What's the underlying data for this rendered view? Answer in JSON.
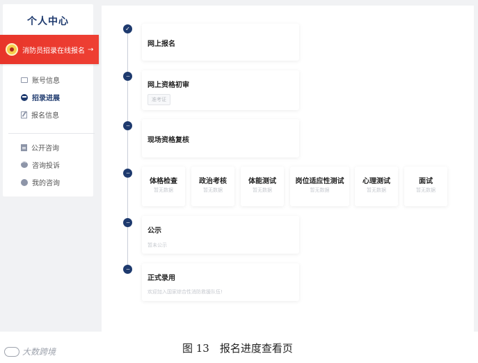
{
  "sidebar": {
    "title": "个人中心",
    "signup_button": "消防员招录在线报名",
    "signup_arrow": "→",
    "menu_primary": [
      {
        "label": "账号信息",
        "icon": "id-card-icon",
        "active": false
      },
      {
        "label": "招录进展",
        "icon": "progress-circle-icon",
        "active": true
      },
      {
        "label": "报名信息",
        "icon": "edit-icon",
        "active": false
      }
    ],
    "menu_secondary": [
      {
        "label": "公开咨询",
        "icon": "document-icon"
      },
      {
        "label": "咨询投诉",
        "icon": "chat-icon"
      },
      {
        "label": "我的咨询",
        "icon": "user-icon"
      }
    ]
  },
  "timeline": {
    "steps": [
      {
        "title": "网上报名",
        "status": "completed"
      },
      {
        "title": "网上资格初审",
        "button": "准考证"
      },
      {
        "title": "现场资格复核"
      },
      {
        "title": "公示",
        "note": "暂未公示"
      },
      {
        "title": "正式录用",
        "note": "欢迎加入国家综合性消防救援队伍!"
      }
    ],
    "exam_items": [
      {
        "title": "体格检查",
        "status": "暂无数据"
      },
      {
        "title": "政治考核",
        "status": "暂无数据"
      },
      {
        "title": "体能测试",
        "status": "暂无数据"
      },
      {
        "title": "岗位适应性测试",
        "status": "暂无数据"
      },
      {
        "title": "心理测试",
        "status": "暂无数据"
      },
      {
        "title": "面试",
        "status": "暂无数据"
      }
    ]
  },
  "caption": {
    "watermark": "大数跨境",
    "figure": "图 13　报名进度查看页"
  },
  "colors": {
    "brand_navy": "#1e3a6e",
    "signup_red": "#e8352a",
    "background": "#f1f2f4"
  }
}
